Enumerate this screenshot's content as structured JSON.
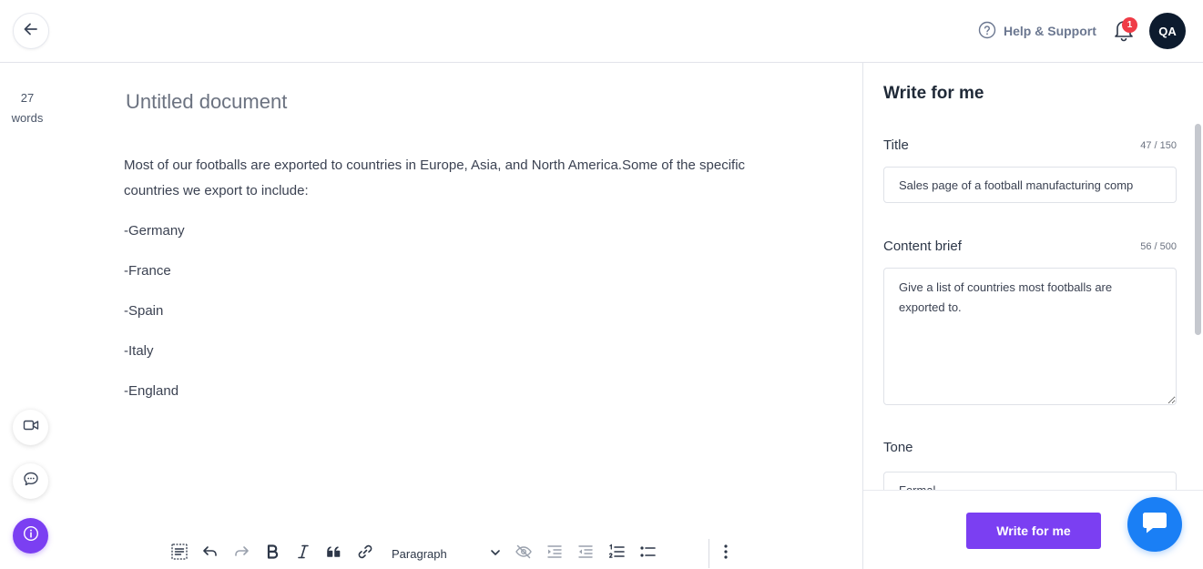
{
  "header": {
    "back_icon": "arrow-left-icon",
    "help_label": "Help & Support",
    "notification_count": "1",
    "avatar_initials": "QA"
  },
  "sidebar": {
    "word_count_number": "27",
    "word_count_unit": "words"
  },
  "document": {
    "title": "Untitled document",
    "paragraphs": [
      "Most of our footballs are exported to countries in Europe, Asia, and North America.Some of the specific countries we export to include:",
      "-Germany",
      "-France",
      "-Spain",
      "-Italy",
      "-England"
    ]
  },
  "toolbar": {
    "block_style": "Paragraph",
    "buttons": [
      "select-all-icon",
      "undo-icon",
      "redo-icon",
      "bold-icon",
      "italic-icon",
      "quote-icon",
      "link-icon",
      "hide-icon",
      "indent-icon",
      "outdent-icon",
      "numbered-list-icon",
      "bullet-list-icon",
      "more-icon"
    ]
  },
  "panel": {
    "title": "Write for me",
    "title_label": "Title",
    "title_count": "47 / 150",
    "title_value": "Sales page of a football manufacturing comp",
    "brief_label": "Content brief",
    "brief_count": "56 / 500",
    "brief_value": "Give a list of countries most footballs are exported to.",
    "tone_label": "Tone",
    "tone_value": "Formal",
    "submit_label": "Write for me"
  },
  "colors": {
    "accent": "#7b3ff2",
    "chat": "#1a7ff5",
    "badge": "#ef3b46",
    "avatar": "#0d1b2e"
  }
}
